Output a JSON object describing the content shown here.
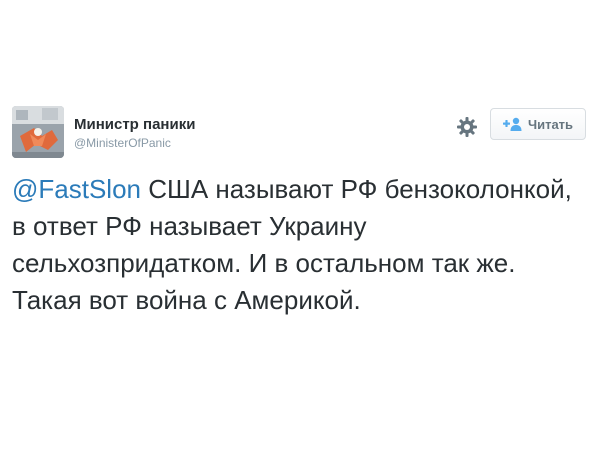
{
  "tweet": {
    "author": {
      "display_name": "Министр паники",
      "screen_name": "@MinisterOfPanic",
      "avatar_icon": "avatar-image"
    },
    "actions": {
      "settings_icon": "gear-icon",
      "follow_label": "Читать",
      "follow_icon": "add-user-icon"
    },
    "mention": "@FastSlon",
    "text": " США называют РФ бензоколонкой, в ответ РФ называет Украину сельхозпридатком. И в остальном так же. Такая вот война с Америкой."
  },
  "colors": {
    "text": "#292f33",
    "mention": "#2b7bb9",
    "muted": "#8899a6",
    "follow_icon": "#55acee"
  }
}
